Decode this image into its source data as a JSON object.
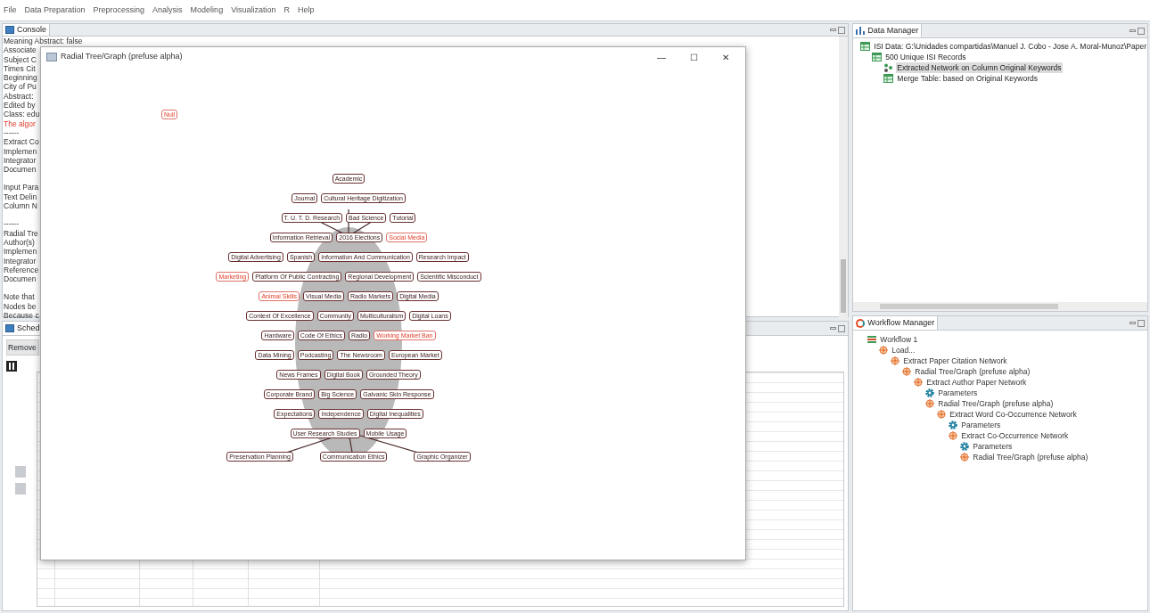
{
  "menu": [
    "File",
    "Data Preparation",
    "Preprocessing",
    "Analysis",
    "Modeling",
    "Visualization",
    "R",
    "Help"
  ],
  "console": {
    "title": "Console",
    "lines": [
      {
        "text": "Meaning Abstract: false",
        "kind": "normal"
      },
      {
        "text": "Associate",
        "kind": "normal"
      },
      {
        "text": "Subject C",
        "kind": "normal"
      },
      {
        "text": "Times Cit",
        "kind": "normal"
      },
      {
        "text": "Beginning",
        "kind": "normal"
      },
      {
        "text": "City of Pu",
        "kind": "normal"
      },
      {
        "text": "Abstract: ",
        "kind": "normal"
      },
      {
        "text": "Edited by",
        "kind": "normal"
      },
      {
        "text": "Class: edu",
        "kind": "normal"
      },
      {
        "text": "The algor",
        "kind": "error"
      },
      {
        "text": "------",
        "kind": "normal"
      },
      {
        "text": "Extract Co",
        "kind": "normal"
      },
      {
        "text": "Implemen",
        "kind": "normal"
      },
      {
        "text": "Integrator",
        "kind": "normal"
      },
      {
        "text": "Documen",
        "kind": "normal"
      },
      {
        "text": "Input Para",
        "kind": "gap"
      },
      {
        "text": "Text Delin",
        "kind": "normal"
      },
      {
        "text": "Column N",
        "kind": "normal"
      },
      {
        "text": "------",
        "kind": "gap"
      },
      {
        "text": "Radial Tre",
        "kind": "normal"
      },
      {
        "text": "Author(s)",
        "kind": "normal"
      },
      {
        "text": "Implemen",
        "kind": "normal"
      },
      {
        "text": "Integrator",
        "kind": "normal"
      },
      {
        "text": "Reference",
        "kind": "normal"
      },
      {
        "text": "Documen",
        "kind": "normal"
      },
      {
        "text": "Note that",
        "kind": "gap"
      },
      {
        "text": "Nodes be",
        "kind": "normal"
      },
      {
        "text": "Because c",
        "kind": "normal"
      }
    ]
  },
  "scheduler": {
    "title": "Sched",
    "remove_button": "Remove"
  },
  "graph_window": {
    "title": "Radial Tree/Graph (prefuse alpha)",
    "minimize": "—",
    "maximize": "☐",
    "close": "✕",
    "isolated_node": {
      "label": "Null",
      "highlighted": true
    },
    "nodes": [
      {
        "label": "Academic",
        "highlighted": false
      },
      {
        "label": "Journal",
        "highlighted": false
      },
      {
        "label": "Cultural Heritage Digitization",
        "highlighted": false
      },
      {
        "label": "T. U. T. D. Research",
        "highlighted": false
      },
      {
        "label": "Bad Science",
        "highlighted": false
      },
      {
        "label": "Tutorial",
        "highlighted": false
      },
      {
        "label": "Information Retrieval",
        "highlighted": false
      },
      {
        "label": "2016 Elections",
        "highlighted": false
      },
      {
        "label": "Social Media",
        "highlighted": true
      },
      {
        "label": "Digital Advertising",
        "highlighted": false
      },
      {
        "label": "Spanish",
        "highlighted": false
      },
      {
        "label": "Information And Communication",
        "highlighted": false
      },
      {
        "label": "Research Impact",
        "highlighted": false
      },
      {
        "label": "Marketing",
        "highlighted": true
      },
      {
        "label": "Platform Of Public Contracting",
        "highlighted": false
      },
      {
        "label": "Regional Development",
        "highlighted": false
      },
      {
        "label": "Scientific Misconduct",
        "highlighted": false
      },
      {
        "label": "Animal Skills",
        "highlighted": true
      },
      {
        "label": "Visual Media",
        "highlighted": false
      },
      {
        "label": "Radio Markets",
        "highlighted": false
      },
      {
        "label": "Digital Media",
        "highlighted": false
      },
      {
        "label": "Context Of Excellence",
        "highlighted": false
      },
      {
        "label": "Community",
        "highlighted": false
      },
      {
        "label": "Multiculturalism",
        "highlighted": false
      },
      {
        "label": "Digital Loans",
        "highlighted": false
      },
      {
        "label": "Hardware",
        "highlighted": false
      },
      {
        "label": "Code Of Ethics",
        "highlighted": false
      },
      {
        "label": "Radio",
        "highlighted": false
      },
      {
        "label": "Working Market Ban",
        "highlighted": true
      },
      {
        "label": "Data Mining",
        "highlighted": false
      },
      {
        "label": "Podcasting",
        "highlighted": false
      },
      {
        "label": "The Newsroom",
        "highlighted": false
      },
      {
        "label": "European Market",
        "highlighted": false
      },
      {
        "label": "News Frames",
        "highlighted": false
      },
      {
        "label": "Digital Book",
        "highlighted": false
      },
      {
        "label": "Grounded Theory",
        "highlighted": false
      },
      {
        "label": "Corporate Brand",
        "highlighted": false
      },
      {
        "label": "Big Science",
        "highlighted": false
      },
      {
        "label": "Galvanic Skin Response",
        "highlighted": false
      },
      {
        "label": "Expectations",
        "highlighted": false
      },
      {
        "label": "Independence",
        "highlighted": false
      },
      {
        "label": "Digital Inequalities",
        "highlighted": false
      },
      {
        "label": "User Research Studies",
        "highlighted": false
      },
      {
        "label": "Mobile Usage",
        "highlighted": false
      }
    ],
    "outer_nodes": [
      {
        "label": "Preservation Planning",
        "highlighted": false
      },
      {
        "label": "Communication Ethics",
        "highlighted": false
      },
      {
        "label": "Graphic Organizer",
        "highlighted": false
      }
    ]
  },
  "data_manager": {
    "title": "Data Manager",
    "items": [
      {
        "label": "ISI Data: G:\\Unidades compartidas\\Manuel J. Cobo - Jose A. Moral-Munoz\\Paper",
        "kind": "table",
        "selected": false,
        "children": [
          {
            "label": "500 Unique ISI Records",
            "kind": "table",
            "selected": false,
            "children": [
              {
                "label": "Extracted Network on Column Original Keywords",
                "kind": "network",
                "selected": true
              },
              {
                "label": "Merge Table: based on Original Keywords",
                "kind": "table",
                "selected": false
              }
            ]
          }
        ]
      }
    ]
  },
  "workflow_manager": {
    "title": "Workflow Manager",
    "items": [
      {
        "label": "Workflow 1",
        "kind": "workflow",
        "children": [
          {
            "label": "Load...",
            "kind": "algorithm",
            "children": [
              {
                "label": "Extract Paper Citation Network",
                "kind": "algorithm",
                "children": [
                  {
                    "label": "Radial Tree/Graph (prefuse alpha)",
                    "kind": "algorithm",
                    "children": [
                      {
                        "label": "Extract Author Paper Network",
                        "kind": "algorithm",
                        "children": [
                          {
                            "label": "Parameters",
                            "kind": "parameters"
                          },
                          {
                            "label": "Radial Tree/Graph (prefuse alpha)",
                            "kind": "algorithm",
                            "children": [
                              {
                                "label": "Extract Word Co-Occurrence Network",
                                "kind": "algorithm",
                                "children": [
                                  {
                                    "label": "Parameters",
                                    "kind": "parameters"
                                  },
                                  {
                                    "label": "Extract Co-Occurrence Network",
                                    "kind": "algorithm",
                                    "children": [
                                      {
                                        "label": "Parameters",
                                        "kind": "parameters"
                                      },
                                      {
                                        "label": "Radial Tree/Graph (prefuse alpha)",
                                        "kind": "algorithm"
                                      }
                                    ]
                                  }
                                ]
                              }
                            ]
                          }
                        ]
                      }
                    ]
                  }
                ]
              }
            ]
          }
        ]
      }
    ]
  }
}
